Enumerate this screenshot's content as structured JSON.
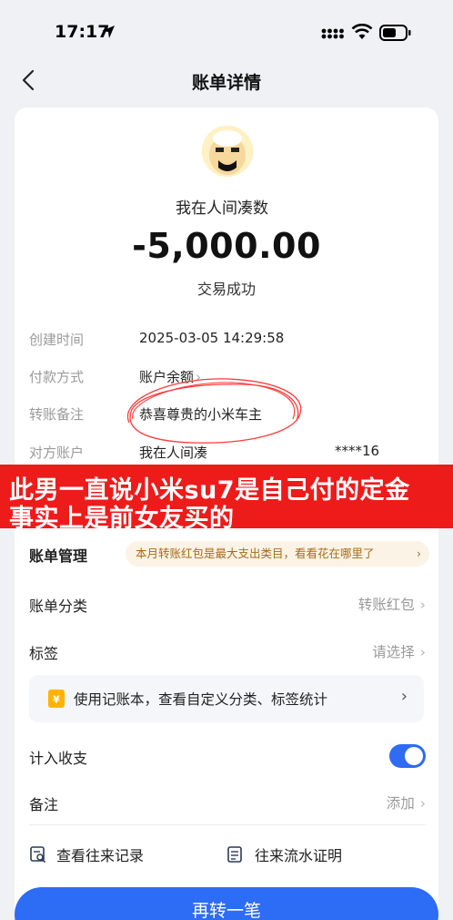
{
  "status_bar": {
    "time": "17:17"
  },
  "nav": {
    "title": "账单详情"
  },
  "payee": {
    "name": "我在人间凑数"
  },
  "amount": "-5,000.00",
  "status": "交易成功",
  "details": [
    {
      "label": "创建时间",
      "value": "2025-03-05 14:29:58"
    },
    {
      "label": "付款方式",
      "value": "账户余额"
    },
    {
      "label": "转账备注",
      "value": "恭喜尊贵的小米车主"
    },
    {
      "label": "对方账户",
      "value": "我在人间凑",
      "suffix": "****16"
    }
  ],
  "overlay_banner": {
    "line1": "此男一直说小米su7是自己付的定金",
    "line2": "事实上是前女友买的"
  },
  "bill_management": {
    "title": "账单管理",
    "tip": "本月转账红包是最大支出类目，看看花在哪里了"
  },
  "category": {
    "label": "账单分类",
    "value": "转账红包"
  },
  "tag": {
    "label": "标签",
    "value": "请选择"
  },
  "promo": {
    "text": "使用记账本，查看自定义分类、标签统计"
  },
  "income_expense": {
    "label": "计入收支",
    "enabled": true
  },
  "note": {
    "label": "备注",
    "value": "添加"
  },
  "links": {
    "records": "查看往来记录",
    "statement": "往来流水证明"
  },
  "primary_button": "再转一笔",
  "colors": {
    "accent": "#2d6cf5",
    "banner": "#ee1b1b",
    "tip_text": "#a86a1b"
  }
}
